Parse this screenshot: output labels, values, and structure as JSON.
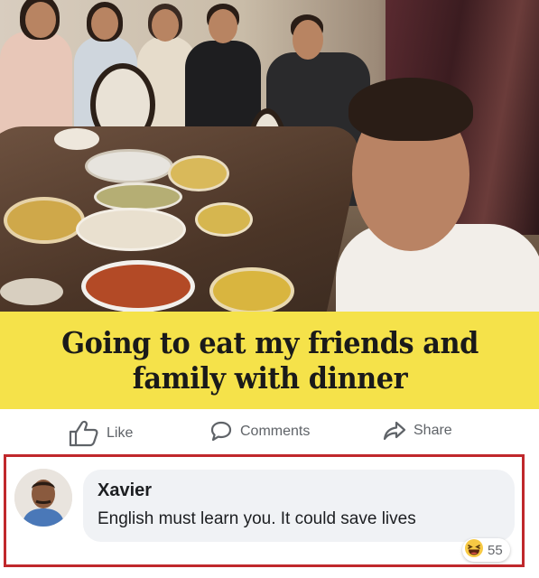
{
  "post": {
    "caption": "Going to eat my friends and family with dinner"
  },
  "actions": {
    "like_label": "Like",
    "comments_label": "Comments",
    "share_label": "Share"
  },
  "comment": {
    "author": "Xavier",
    "text": "English must learn you. It could save lives",
    "reaction_icon": "haha-emoji-icon",
    "reaction_count": "55"
  },
  "colors": {
    "caption_background": "#f5e24a",
    "highlight_border": "#c0282c",
    "bubble_background": "#f0f2f5"
  }
}
